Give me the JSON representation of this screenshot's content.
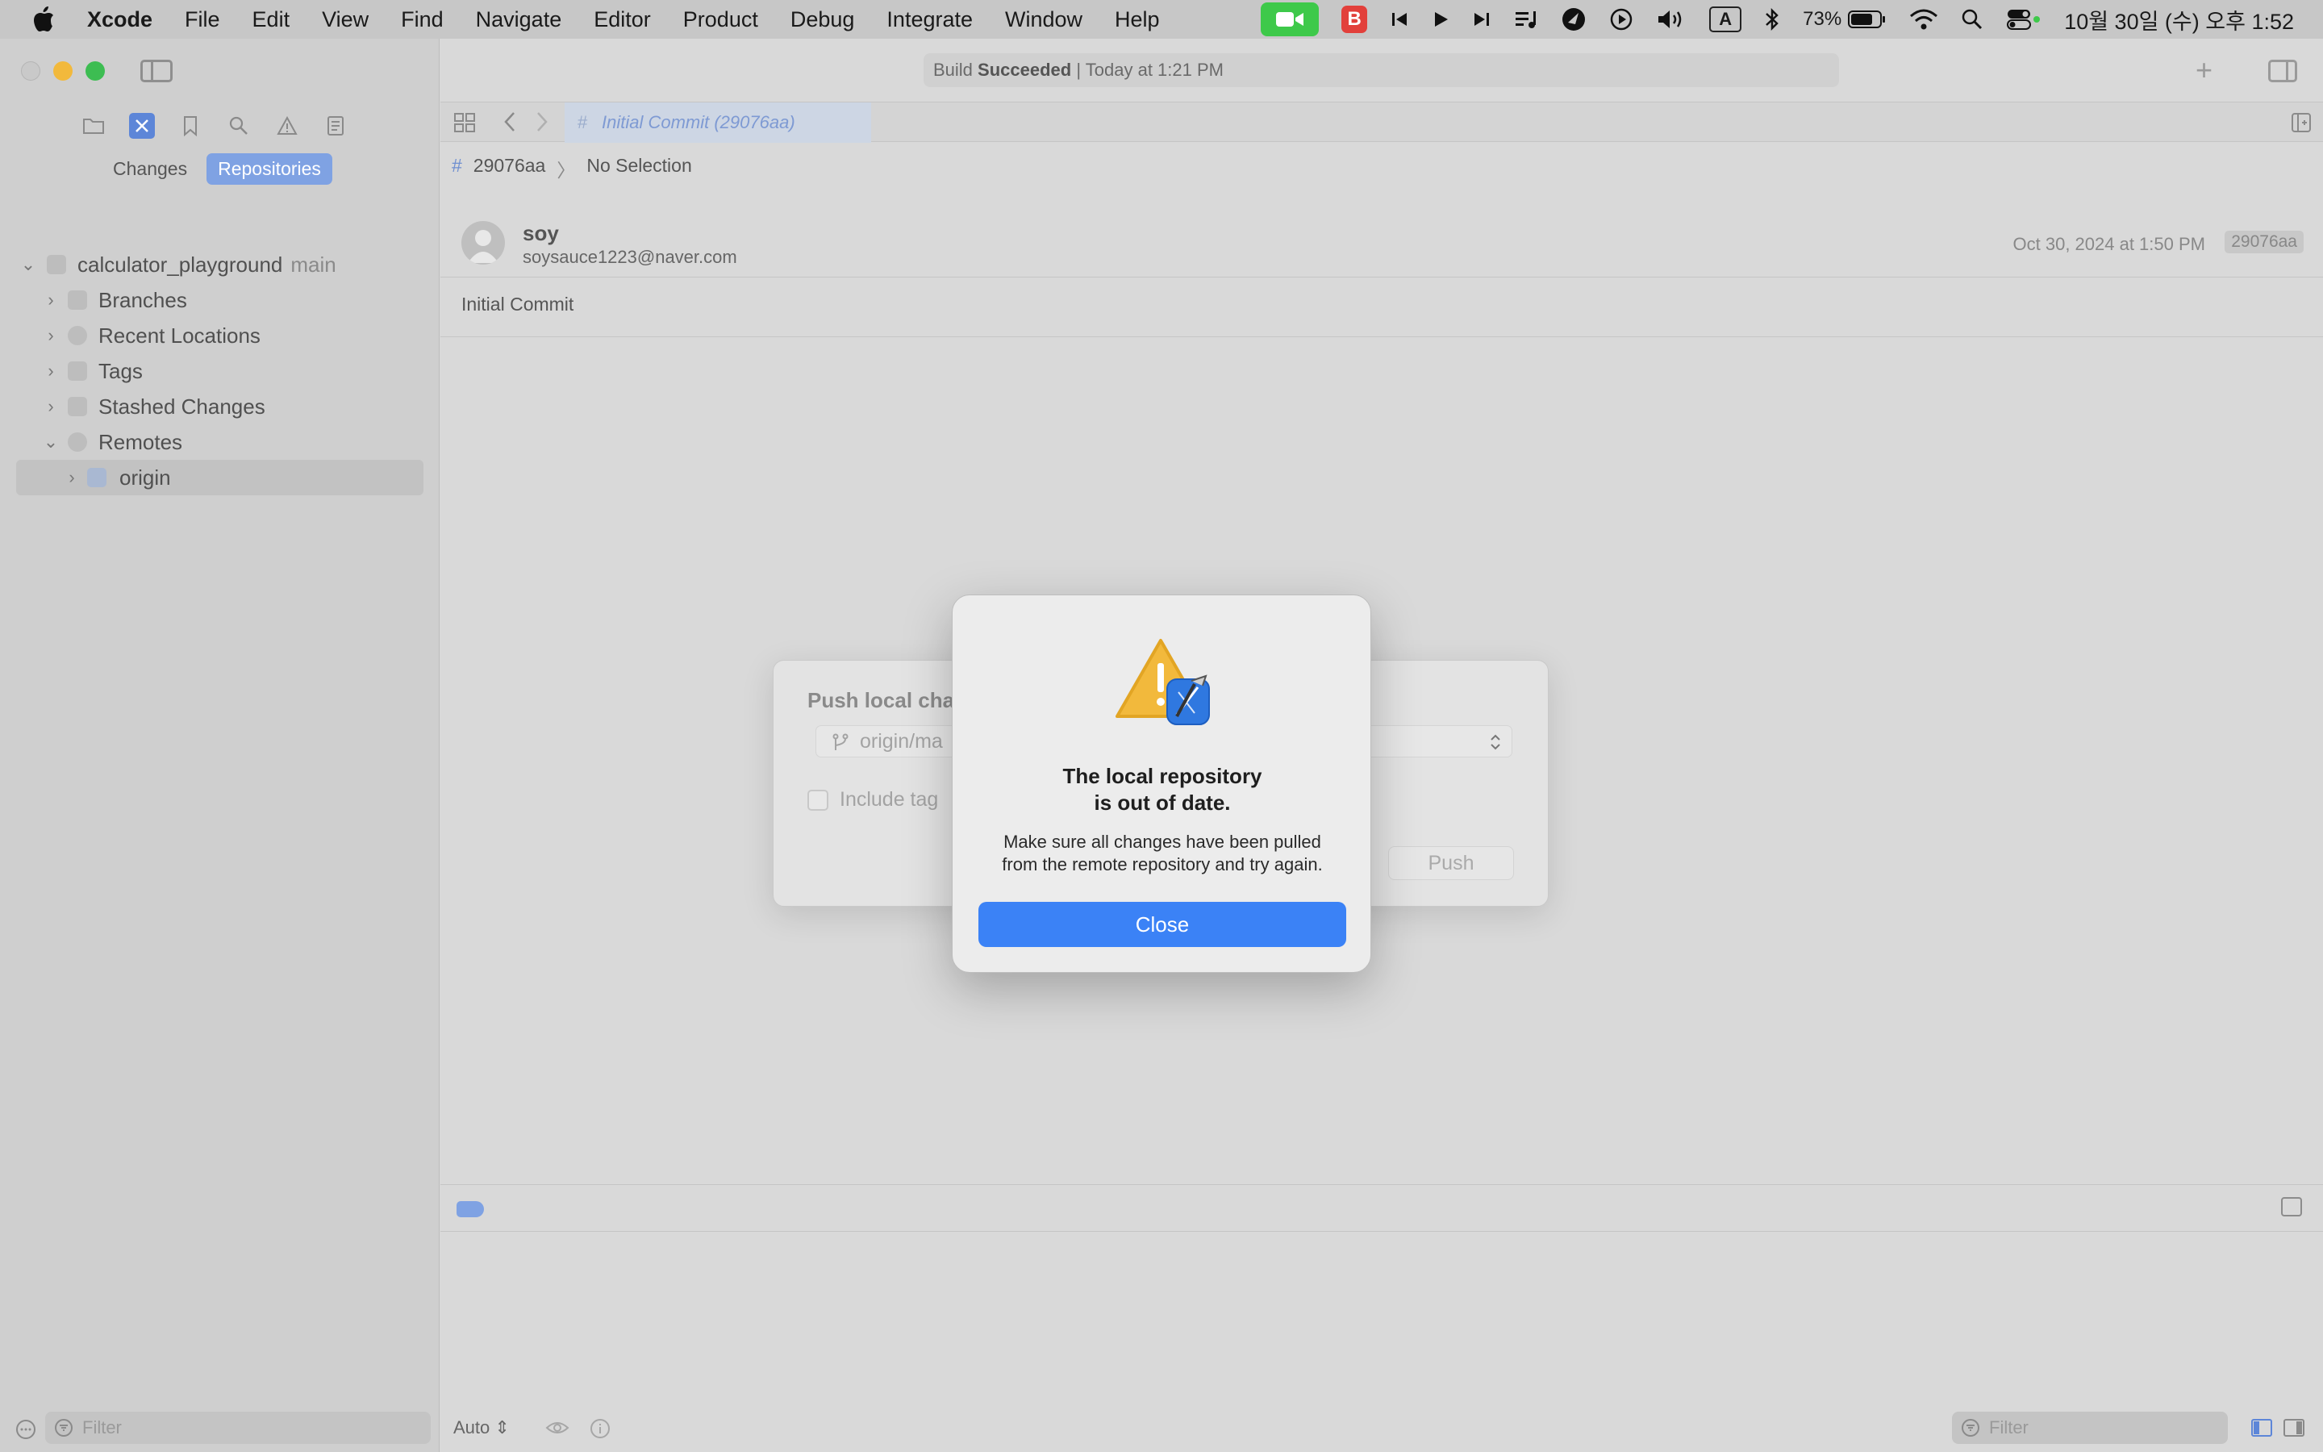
{
  "menubar": {
    "app_name": "Xcode",
    "items": [
      "File",
      "Edit",
      "View",
      "Find",
      "Navigate",
      "Editor",
      "Product",
      "Debug",
      "Integrate",
      "Window",
      "Help"
    ],
    "status": {
      "b_badge": "B",
      "input_source": "A",
      "battery_percent": "73%",
      "clock": "10월 30일 (수) 오후 1:52"
    }
  },
  "toolbar": {
    "status_prefix": "Build",
    "status_bold": "Succeeded",
    "status_suffix": "| Today at 1:21 PM"
  },
  "navigator": {
    "segments": {
      "changes": "Changes",
      "repositories": "Repositories"
    },
    "repo": {
      "name": "calculator_playground",
      "branch": "main"
    },
    "items": {
      "branches": "Branches",
      "recent_locations": "Recent Locations",
      "tags": "Tags",
      "stashed_changes": "Stashed Changes",
      "remotes": "Remotes",
      "origin": "origin"
    },
    "filter_placeholder": "Filter"
  },
  "editor": {
    "tab_label": "Initial Commit (29076aa)",
    "breadcrumb": {
      "hash": "29076aa",
      "selection": "No Selection"
    },
    "commit": {
      "author": "soy",
      "email": "soysauce1223@naver.com",
      "date": "Oct 30, 2024 at 1:50 PM",
      "hash": "29076aa",
      "message": "Initial Commit"
    },
    "auto_label": "Auto",
    "filter_placeholder": "Filter"
  },
  "push_sheet": {
    "title": "Push local cha",
    "remote_branch": "origin/ma",
    "include_tags": "Include tag",
    "push_label": "Push"
  },
  "alert": {
    "title_line1": "The local repository",
    "title_line2": "is out of date.",
    "message_line1": "Make sure all changes have been pulled",
    "message_line2": "from the remote repository and try again.",
    "close_label": "Close"
  },
  "colors": {
    "accent": "#3b82f6",
    "selected_segment": "#7fa2e3",
    "warning": "#f2b93c"
  }
}
